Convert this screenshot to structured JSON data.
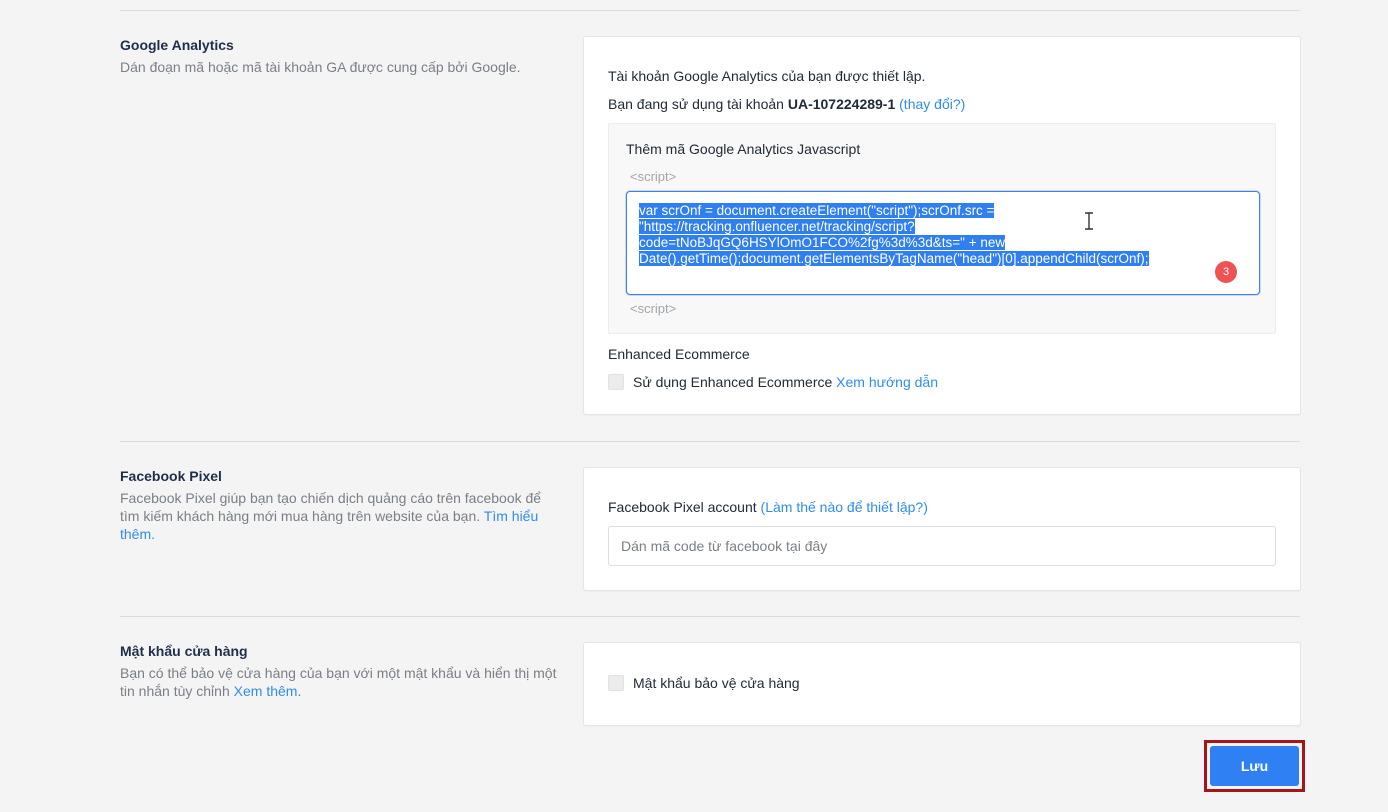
{
  "google_analytics": {
    "title": "Google Analytics",
    "description": "Dán đoạn mã hoặc mã tài khoản GA được cung cấp bởi Google.",
    "status_text": "Tài khoản Google Analytics của bạn được thiết lập.",
    "account_prefix": "Bạn đang sử dụng tài khoản",
    "account_id": "UA-107224289-1",
    "change_link": "(thay đổi?)",
    "js_box_title": "Thêm mã Google Analytics Javascript",
    "script_open_tag": "<script>",
    "script_close_tag": "<script>",
    "code_lines": [
      "var scrOnf = document.createElement(\"script\");scrOnf.src =",
      "\"https://tracking.onfluencer.net/tracking/script?",
      "code=tNoBJqGQ6HSYlOmO1FCO%2fg%3d%3d&ts=\" + new",
      "Date().getTime();document.getElementsByTagName(\"head\")[0].appendChild(scrOnf);"
    ],
    "badge_count": "3",
    "enhanced_title": "Enhanced Ecommerce",
    "enhanced_checkbox_label": "Sử dụng Enhanced Ecommerce",
    "enhanced_guide_link": "Xem hướng dẫn"
  },
  "facebook_pixel": {
    "title": "Facebook Pixel",
    "description": "Facebook Pixel giúp bạn tạo chiến dịch quảng cáo trên facebook để tìm kiếm khách hàng mới mua hàng trên website của bạn.",
    "learn_more_link": "Tìm hiểu thêm.",
    "account_label": "Facebook Pixel account",
    "setup_link": "(Làm thế nào để thiết lập?)",
    "input_placeholder": "Dán mã code từ facebook tại đây"
  },
  "store_password": {
    "title": "Mật khẩu cửa hàng",
    "description": "Bạn có thể bảo vệ cửa hàng của bạn với một mật khẩu và hiển thị một tin nhắn tùy chỉnh",
    "see_more_link": "Xem thêm.",
    "checkbox_label": "Mật khẩu bảo vệ cửa hàng"
  },
  "save_label": "Lưu",
  "colors": {
    "accent": "#2f80f2",
    "badge": "#ee5252",
    "highlight_frame": "#a4161a",
    "selection": "#2f7ff0"
  }
}
